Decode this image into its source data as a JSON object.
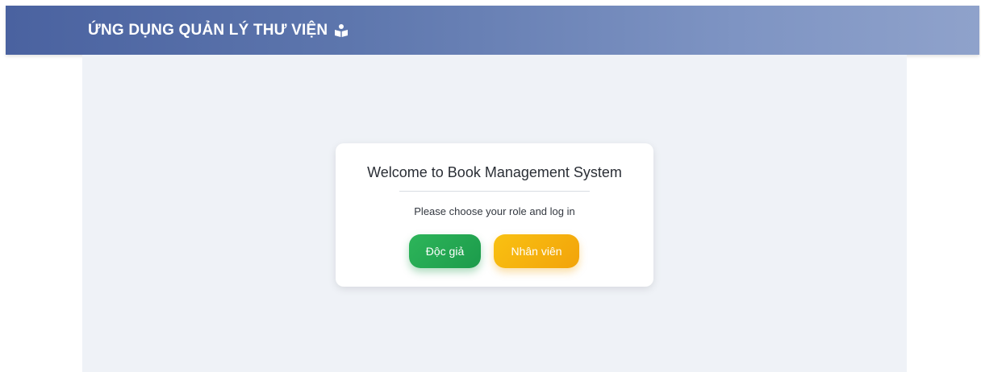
{
  "header": {
    "title": "ỨNG DỤNG QUẢN LÝ THƯ VIỆN",
    "icon": "reading-person-icon",
    "gradient_start": "#4a62a0",
    "gradient_end": "#8fa2cb"
  },
  "welcome_card": {
    "title": "Welcome to Book Management System",
    "subtitle": "Please choose your role and log in",
    "buttons": {
      "reader_label": "Độc giả",
      "reader_color": "#1f9f4e",
      "staff_label": "Nhân viên",
      "staff_color": "#f5ad0c"
    }
  },
  "colors": {
    "page_background": "#eff2f7",
    "card_background": "#ffffff"
  }
}
